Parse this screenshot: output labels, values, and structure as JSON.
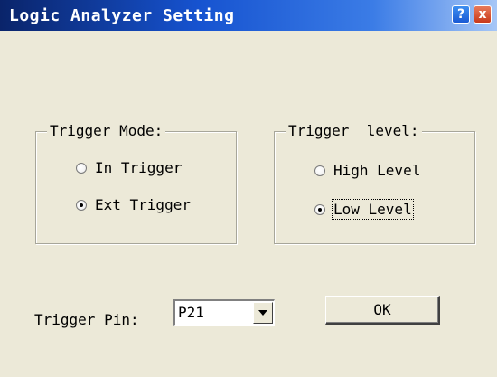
{
  "window": {
    "title": "Logic Analyzer Setting",
    "help_label": "?",
    "close_label": "x"
  },
  "trigger_mode": {
    "legend": "Trigger Mode:",
    "options": [
      {
        "label": "In Trigger",
        "selected": false
      },
      {
        "label": "Ext Trigger",
        "selected": true
      }
    ]
  },
  "trigger_level": {
    "legend": "Trigger  level:",
    "options": [
      {
        "label": "High Level",
        "selected": false
      },
      {
        "label": "Low Level",
        "selected": true
      }
    ]
  },
  "trigger_pin": {
    "label": "Trigger Pin:",
    "value": "P21"
  },
  "ok_button": {
    "label": "OK"
  }
}
